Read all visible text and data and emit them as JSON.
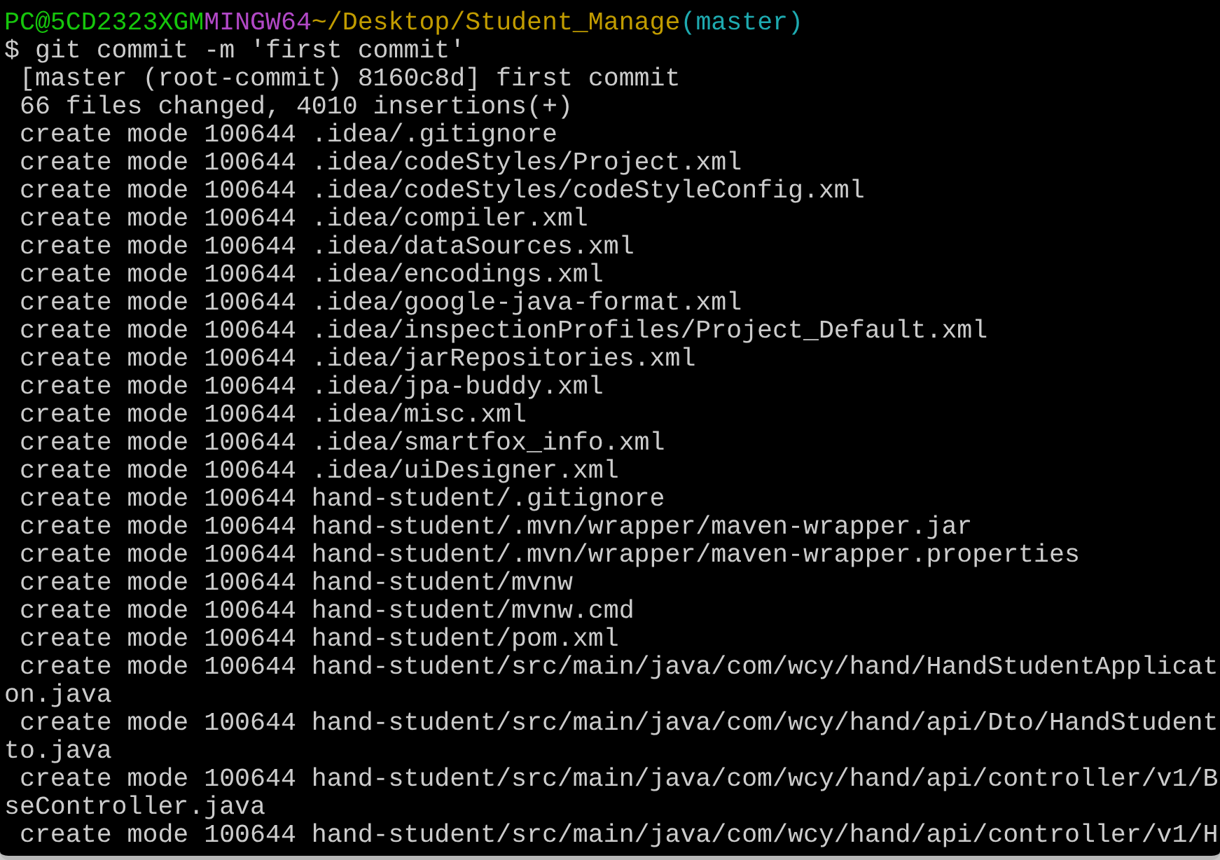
{
  "prompt": {
    "user_host": "PC@5CD2323XGM",
    "system": "MINGW64",
    "path": "~/Desktop/Student_Manage",
    "branch": "(master)"
  },
  "command": "$ git commit -m 'first commit'",
  "output": [
    " [master (root-commit) 8160c8d] first commit",
    " 66 files changed, 4010 insertions(+)",
    " create mode 100644 .idea/.gitignore",
    " create mode 100644 .idea/codeStyles/Project.xml",
    " create mode 100644 .idea/codeStyles/codeStyleConfig.xml",
    " create mode 100644 .idea/compiler.xml",
    " create mode 100644 .idea/dataSources.xml",
    " create mode 100644 .idea/encodings.xml",
    " create mode 100644 .idea/google-java-format.xml",
    " create mode 100644 .idea/inspectionProfiles/Project_Default.xml",
    " create mode 100644 .idea/jarRepositories.xml",
    " create mode 100644 .idea/jpa-buddy.xml",
    " create mode 100644 .idea/misc.xml",
    " create mode 100644 .idea/smartfox_info.xml",
    " create mode 100644 .idea/uiDesigner.xml",
    " create mode 100644 hand-student/.gitignore",
    " create mode 100644 hand-student/.mvn/wrapper/maven-wrapper.jar",
    " create mode 100644 hand-student/.mvn/wrapper/maven-wrapper.properties",
    " create mode 100644 hand-student/mvnw",
    " create mode 100644 hand-student/mvnw.cmd",
    " create mode 100644 hand-student/pom.xml",
    " create mode 100644 hand-student/src/main/java/com/wcy/hand/HandStudentApplicat",
    "on.java",
    " create mode 100644 hand-student/src/main/java/com/wcy/hand/api/Dto/HandStudent",
    "to.java",
    " create mode 100644 hand-student/src/main/java/com/wcy/hand/api/controller/v1/B",
    "seController.java",
    " create mode 100644 hand-student/src/main/java/com/wcy/hand/api/controller/v1/H"
  ]
}
